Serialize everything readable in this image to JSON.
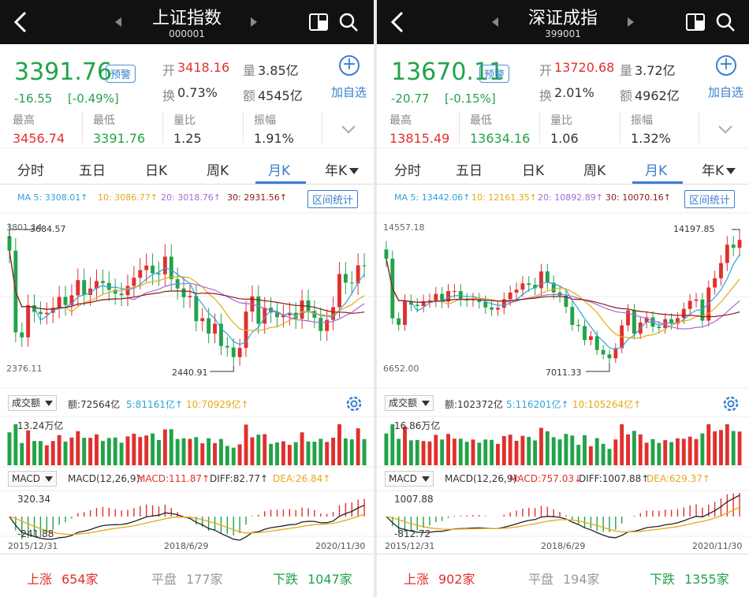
{
  "colors": {
    "up": "#e0302e",
    "down": "#21a34a",
    "accent": "#3a7fd0",
    "ma5": "#2fa3d9",
    "ma10": "#e6a817",
    "ma20": "#a26bd6",
    "ma30": "#8b1a1a",
    "header_bg": "#111111"
  },
  "icons": {
    "back": "chevron-left-icon",
    "prev": "triangle-left-icon",
    "next": "triangle-right-icon",
    "layout": "split-window-icon",
    "search": "search-icon",
    "add": "plus-circle-icon",
    "expand": "chevron-down-icon",
    "settings": "gear-icon",
    "dropdown": "triangle-down-icon"
  },
  "panels": [
    {
      "title": "上证指数",
      "code": "000001",
      "price": "3391.76",
      "alert": "预警",
      "change": "-16.55",
      "change_pct": "[-0.49%]",
      "open_label": "开",
      "open": "3418.16",
      "volume_label": "量",
      "volume": "3.85亿",
      "turnover_label": "换",
      "turnover": "0.73%",
      "amount_label": "额",
      "amount": "4545亿",
      "add_label": "加自选",
      "high_label": "最高",
      "high": "3456.74",
      "low_label": "最低",
      "low": "3391.76",
      "ratio_label": "量比",
      "ratio": "1.25",
      "amp_label": "振幅",
      "amp": "1.91%",
      "tabs": [
        "分时",
        "五日",
        "日K",
        "周K",
        "月K",
        "年K"
      ],
      "active_tab": 4,
      "ma": {
        "ma5": "MA 5: 3308.01↑",
        "ma10": "10: 3086.77↑",
        "ma20": "20: 3018.76↑",
        "ma30": "30: 2931.56↑"
      },
      "range_btn": "区间统计",
      "chart_max_label": "3684.57",
      "chart_top_left": "3801.14",
      "chart_bottom_left": "2376.11",
      "chart_min_label": "2440.91",
      "vol_select": "成交额",
      "vol_amount": "额:72564亿",
      "vol_ma5": "5:81161亿↑",
      "vol_ma10": "10:70929亿↑",
      "vol_max": "13.24万亿",
      "macd_select": "MACD",
      "macd_params": "MACD(12,26,9):",
      "macd_val": "MACD:111.87↑",
      "diff_val": "DIFF:82.77↑",
      "dea_val": "DEA:26.84↑",
      "macd_top": "320.34",
      "macd_bottom": "-241.88",
      "date_start": "2015/12/31",
      "date_mid": "2018/6/29",
      "date_end": "2020/11/30",
      "up_label": "上涨",
      "up_count": "654家",
      "flat_label": "平盘",
      "flat_count": "177家",
      "down_label": "下跌",
      "down_count": "1047家"
    },
    {
      "title": "深证成指",
      "code": "399001",
      "price": "13670.11",
      "alert": "预警",
      "change": "-20.77",
      "change_pct": "[-0.15%]",
      "open_label": "开",
      "open": "13720.68",
      "volume_label": "量",
      "volume": "3.72亿",
      "turnover_label": "换",
      "turnover": "2.01%",
      "amount_label": "额",
      "amount": "4962亿",
      "add_label": "加自选",
      "high_label": "最高",
      "high": "13815.49",
      "low_label": "最低",
      "low": "13634.16",
      "ratio_label": "量比",
      "ratio": "1.06",
      "amp_label": "振幅",
      "amp": "1.32%",
      "tabs": [
        "分时",
        "五日",
        "日K",
        "周K",
        "月K",
        "年K"
      ],
      "active_tab": 4,
      "ma": {
        "ma5": "MA 5: 13442.06↑",
        "ma10": "10: 12161.35↑",
        "ma20": "20: 10892.89↑",
        "ma30": "30: 10070.16↑"
      },
      "range_btn": "区间统计",
      "chart_max_label": "14197.85",
      "chart_top_left": "14557.18",
      "chart_bottom_left": "6652.00",
      "chart_min_label": "7011.33",
      "vol_select": "成交额",
      "vol_amount": "额:102372亿",
      "vol_ma5": "5:116201亿↑",
      "vol_ma10": "10:105264亿↑",
      "vol_max": "16.86万亿",
      "macd_select": "MACD",
      "macd_params": "MACD(12,26,9):",
      "macd_val": "MACD:757.03↓",
      "diff_val": "DIFF:1007.88↑",
      "dea_val": "DEA:629.37↑",
      "macd_top": "1007.88",
      "macd_bottom": "-812.72",
      "date_start": "2015/12/31",
      "date_mid": "2018/6/29",
      "date_end": "2020/11/30",
      "up_label": "上涨",
      "up_count": "902家",
      "flat_label": "平盘",
      "flat_count": "194家",
      "down_label": "下跌",
      "down_count": "1355家"
    }
  ],
  "chart_data": [
    {
      "type": "candlestick",
      "series_source": "上证指数 月K",
      "close": [
        3539,
        2737,
        2688,
        3003,
        2938,
        2916,
        2929,
        2979,
        3085,
        3005,
        3100,
        3250,
        3104,
        3168,
        3241,
        3222,
        3155,
        3117,
        3102,
        3193,
        3273,
        3348,
        3393,
        3317,
        3307,
        3480,
        3259,
        3168,
        3082,
        3095,
        2847,
        2876,
        2725,
        2821,
        2603,
        2588,
        2494,
        2584,
        2941,
        3090,
        2822,
        2979,
        2932,
        2886,
        2905,
        2929,
        2871,
        3050,
        2947,
        2880,
        2750,
        2860,
        2984,
        3310,
        3225,
        3218,
        3395,
        3391
      ],
      "high_label": "3684.57",
      "low_label": "2440.91"
    },
    {
      "type": "candlestick",
      "series_source": "深证成指 月K",
      "close": [
        12665,
        9418,
        9060,
        10355,
        10160,
        10090,
        10350,
        10395,
        10750,
        10330,
        10900,
        10900,
        10430,
        10410,
        10440,
        10305,
        10010,
        9890,
        9990,
        10460,
        10820,
        10980,
        11320,
        11240,
        11060,
        11970,
        11360,
        10830,
        10650,
        10040,
        9060,
        9000,
        8240,
        8440,
        7690,
        7450,
        7240,
        7790,
        9030,
        9850,
        8580,
        9190,
        9470,
        8960,
        8890,
        9370,
        9120,
        9430,
        9930,
        10370,
        10440,
        9290,
        11100,
        11600,
        12430,
        13430,
        13260,
        13690
      ],
      "high_label": "14197.85",
      "low_label": "7011.33"
    }
  ]
}
